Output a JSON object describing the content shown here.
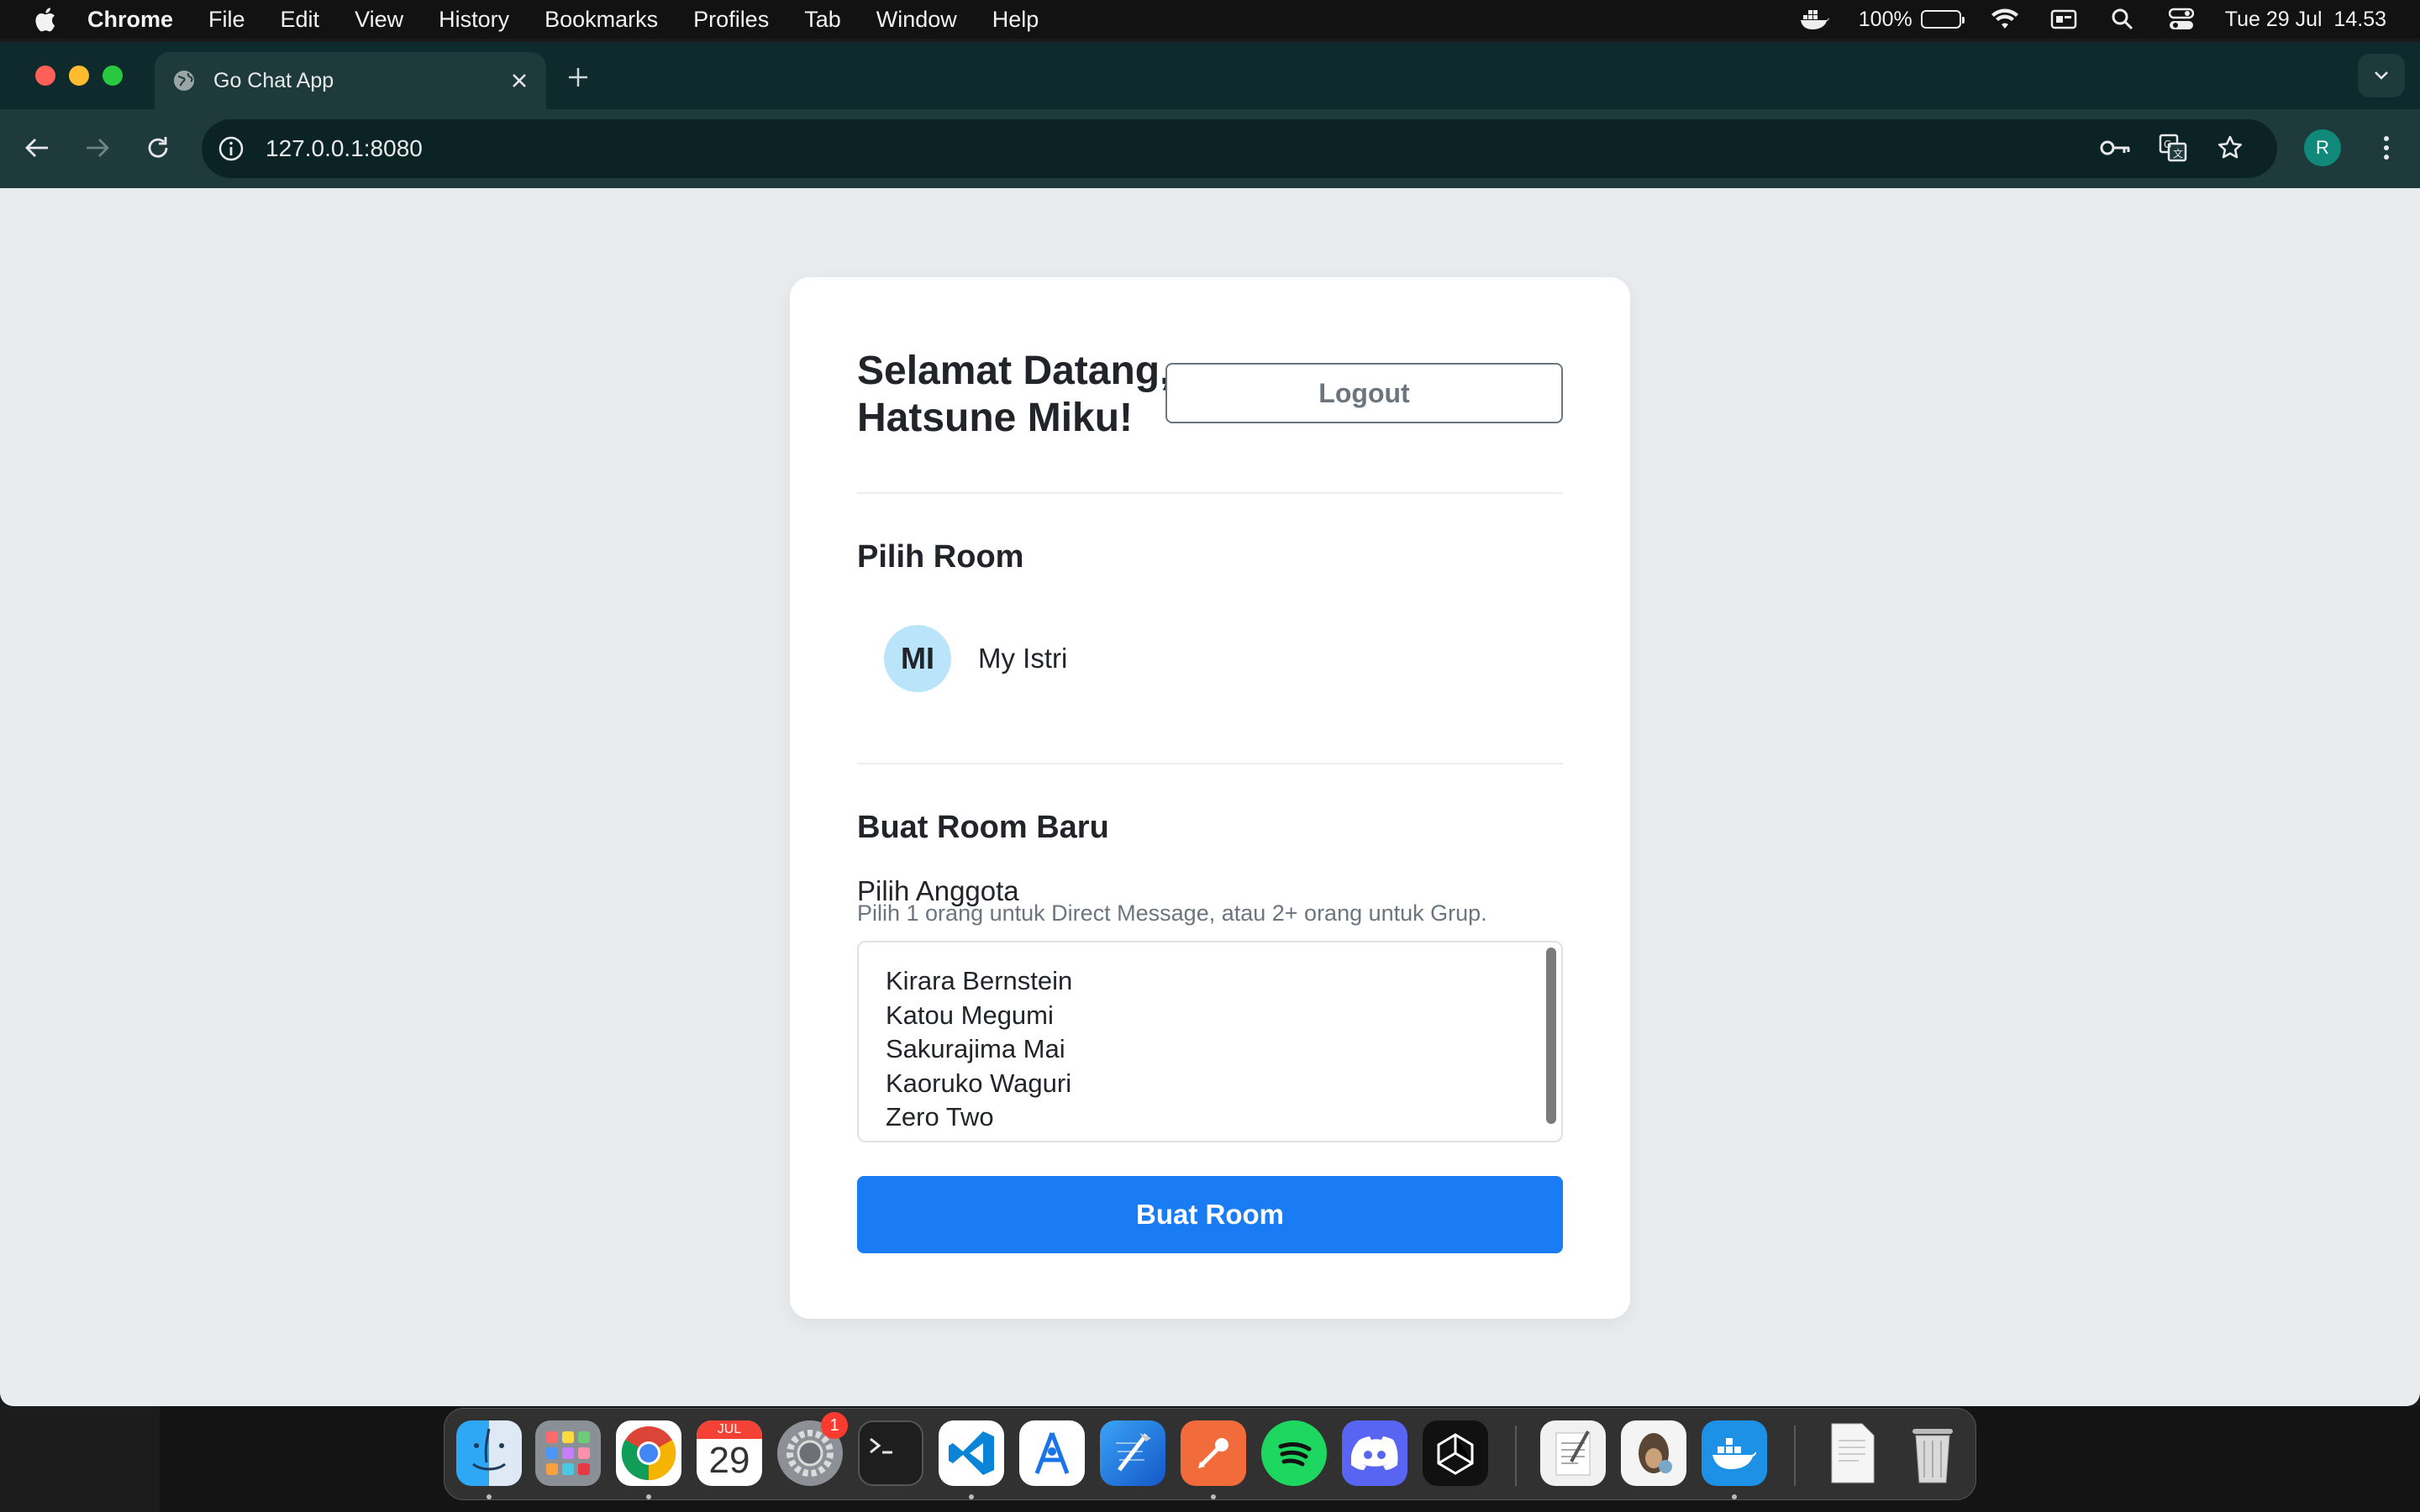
{
  "menubar": {
    "app_name": "Chrome",
    "items": [
      "File",
      "Edit",
      "View",
      "History",
      "Bookmarks",
      "Profiles",
      "Tab",
      "Window",
      "Help"
    ],
    "battery": "100%",
    "datetime": "Tue 29 Jul  14.53"
  },
  "browser": {
    "tab_title": "Go Chat App",
    "url": "127.0.0.1:8080",
    "profile_initial": "R"
  },
  "page": {
    "welcome": "Selamat Datang, Hatsune Miku!",
    "logout_label": "Logout",
    "rooms_title": "Pilih Room",
    "rooms": [
      {
        "initials": "MI",
        "name": "My Istri"
      }
    ],
    "create_title": "Buat Room Baru",
    "members_label": "Pilih Anggota",
    "members_help": "Pilih 1 orang untuk Direct Message, atau 2+ orang untuk Grup.",
    "members": [
      "Kirara Bernstein",
      "Katou Megumi",
      "Sakurajima Mai",
      "Kaoruko Waguri",
      "Zero Two"
    ],
    "create_button": "Buat Room"
  },
  "dock": {
    "calendar_month": "JUL",
    "calendar_day": "29",
    "settings_badge": "1",
    "apps": [
      "Finder",
      "Launchpad",
      "Chrome",
      "Calendar",
      "System Settings",
      "Terminal",
      "VS Code",
      "Xcode Instruments",
      "Xcode",
      "Postman",
      "Spotify",
      "Discord",
      "Unity",
      "TextEdit",
      "Sequel Ace",
      "Docker",
      "Document",
      "Trash"
    ]
  },
  "colors": {
    "accent": "#1a7cf5",
    "avatar_bg": "#b9e4fa",
    "page_bg": "#e9ecef",
    "chrome_toolbar": "#1e3a3b"
  }
}
